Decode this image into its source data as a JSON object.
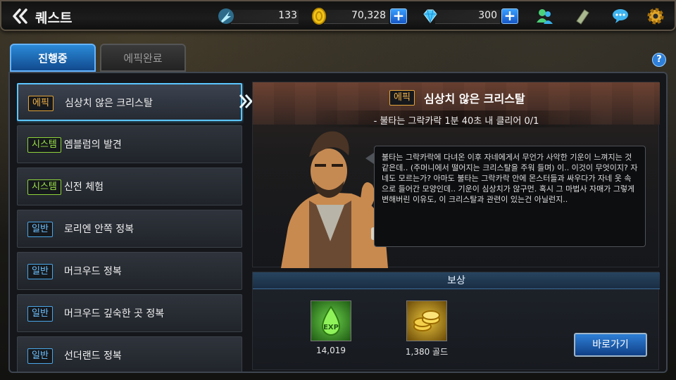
{
  "header": {
    "title": "퀘스트",
    "stamina": "133",
    "gold": "70,328",
    "gems": "300",
    "plus_symbol": "+"
  },
  "tabs": [
    {
      "label": "진행중",
      "active": true
    },
    {
      "label": "에픽완료",
      "active": false
    }
  ],
  "help_label": "?",
  "quests": [
    {
      "category": "에픽",
      "type": "epic",
      "name": "심상치 않은 크리스탈",
      "selected": true
    },
    {
      "category": "시스템",
      "type": "system",
      "name": "엠블럼의 발견"
    },
    {
      "category": "시스템",
      "type": "system",
      "name": "신전 체험"
    },
    {
      "category": "일반",
      "type": "normal",
      "name": "로리엔 안쪽 정복"
    },
    {
      "category": "일반",
      "type": "normal",
      "name": "머크우드 정복"
    },
    {
      "category": "일반",
      "type": "normal",
      "name": "머크우드 깊숙한 곳 정복"
    },
    {
      "category": "일반",
      "type": "normal",
      "name": "선더랜드 정복"
    }
  ],
  "detail": {
    "category": "에픽",
    "title": "심상치 않은 크리스탈",
    "objective": "- 불타는 그락카락 1분 40초 내 클리어 0/1",
    "dialog": "불타는 그락카락에 다녀온 이후 자네에게서 무언가 사악한 기운이 느껴지는 것 같은데.. (주머니에서 떨어지는 크리스탈을 주워 들며) 이.. 이것이 무엇이지? 자네도 모르는가? 아마도 불타는 그락카락 안에 몬스터들과 싸우다가 자네 옷 속으로 들어간 모양인데.. 기운이 심상치가 않구먼. 혹시 그 마법사 자매가 그렇게 변해버린 이유도, 이 크리스탈과 관련이 있는건 아닐런지.."
  },
  "reward": {
    "header": "보상",
    "exp_value": "14,019",
    "exp_label": "EXP",
    "gold_value": "1,380 골드",
    "button": "바로가기"
  },
  "colors": {
    "accent_blue": "#2b8ad8",
    "epic": "#f3b348",
    "system": "#9be246",
    "normal": "#6cc0ff"
  }
}
